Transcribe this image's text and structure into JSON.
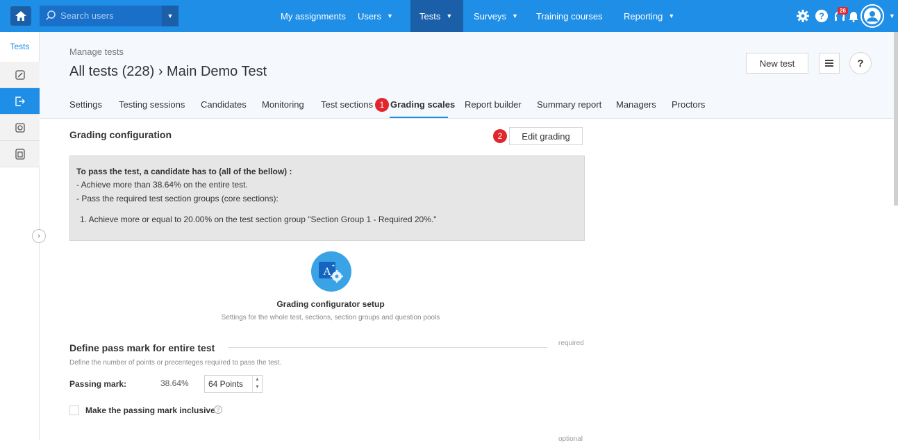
{
  "topbar": {
    "search_placeholder": "Search users",
    "nav": [
      {
        "label": "My assignments"
      },
      {
        "label": "Users"
      },
      {
        "label": "Tests"
      },
      {
        "label": "Surveys"
      },
      {
        "label": "Training courses"
      },
      {
        "label": "Reporting"
      }
    ],
    "notification_count": "26",
    "accent": "#1f8ee6",
    "active_bg": "#1a5fa8"
  },
  "rail": {
    "title": "Tests",
    "icons": [
      "edit-icon",
      "export-icon",
      "circle-square-icon",
      "copy-icon"
    ]
  },
  "header": {
    "breadcrumb_small": "Manage tests",
    "title": "All tests (228) › Main Demo Test",
    "new_test_label": "New test",
    "help_label": "?",
    "tabs": [
      {
        "label": "Settings"
      },
      {
        "label": "Testing sessions"
      },
      {
        "label": "Candidates"
      },
      {
        "label": "Monitoring"
      },
      {
        "label": "Test sections"
      },
      {
        "label": "Grading scales"
      },
      {
        "label": "Report builder"
      },
      {
        "label": "Summary report"
      },
      {
        "label": "Managers"
      },
      {
        "label": "Proctors"
      }
    ],
    "active_tab": "Grading scales"
  },
  "markers": {
    "m1": "1",
    "m2": "2",
    "color": "#e0272c"
  },
  "grading": {
    "title": "Grading configuration",
    "edit_label": "Edit grading",
    "info": {
      "line1": "To pass the test, a candidate has to (all of the bellow) :",
      "line2": "- Achieve more than 38.64% on the entire test.",
      "line3": "- Pass the required test section groups (core sections):",
      "line4": "1.   Achieve more or equal to 20.00% on the test section group \"Section Group 1 - Required 20%.\""
    },
    "setup_title": "Grading configurator setup",
    "setup_sub": "Settings for the whole test, sections, section groups and question pools"
  },
  "passmark": {
    "title": "Define pass mark for entire test",
    "required": "required",
    "desc": "Define the number of points or precenteges required to pass the test.",
    "label": "Passing mark:",
    "percent": "38.64%",
    "value": "64 Points",
    "inclusive_label": "Make the passing mark inclusive",
    "optional": "optional"
  }
}
